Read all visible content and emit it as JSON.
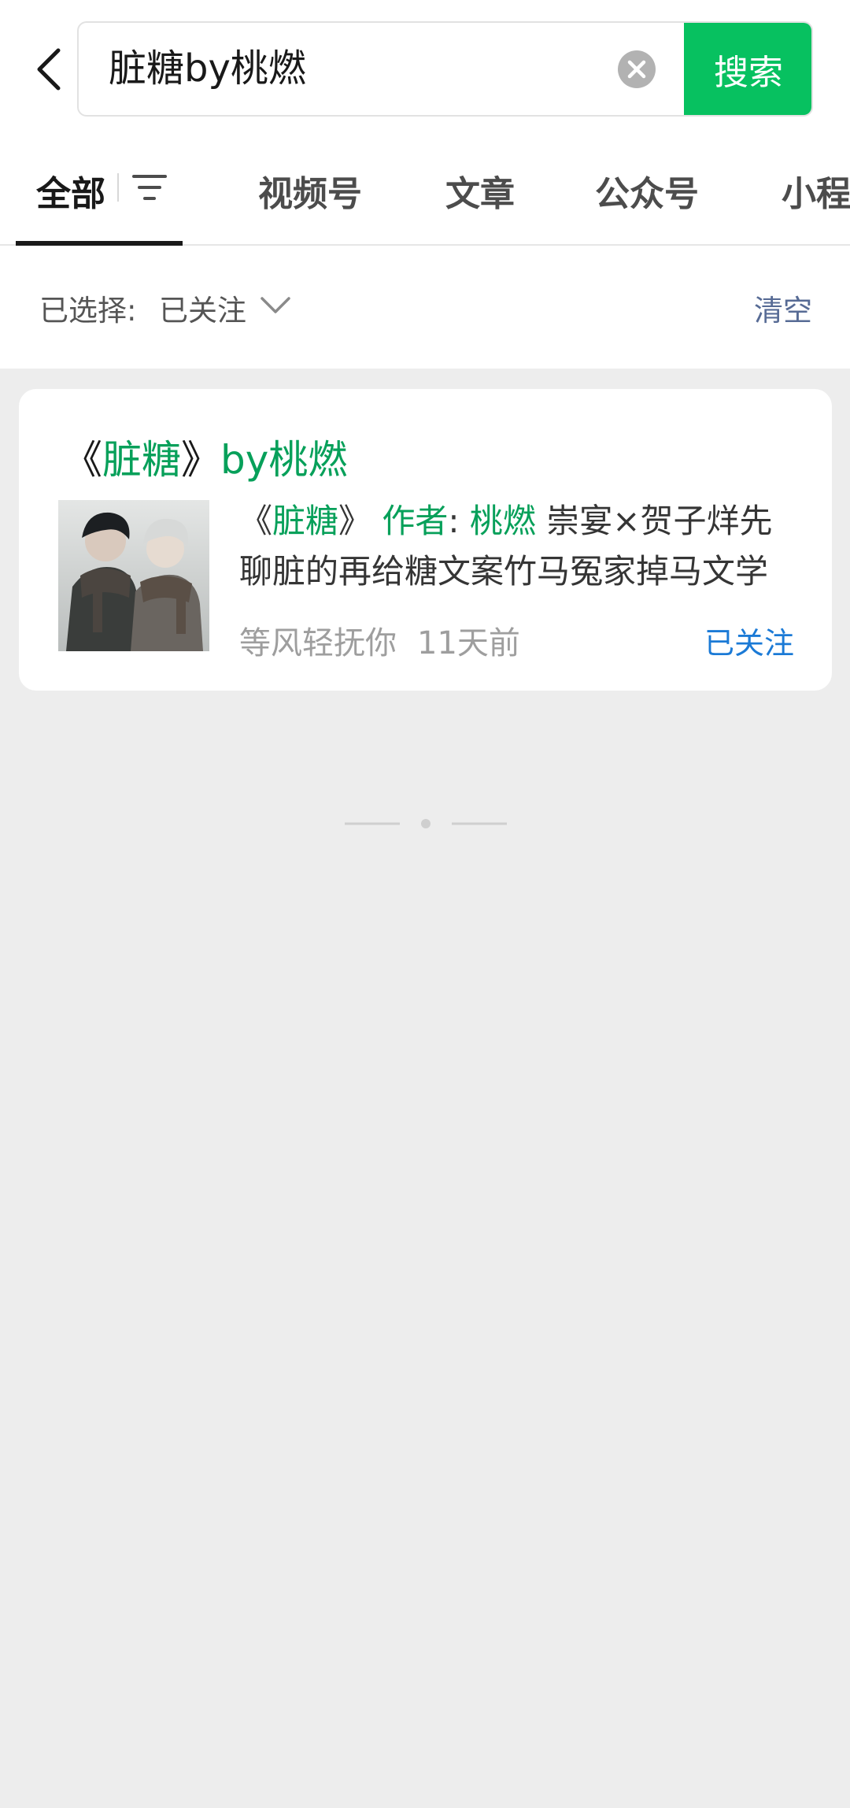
{
  "search": {
    "query": "脏糖by桃燃",
    "button_label": "搜索"
  },
  "tabs": [
    {
      "label": "全部",
      "active": true
    },
    {
      "label": "视频号"
    },
    {
      "label": "文章"
    },
    {
      "label": "公众号"
    },
    {
      "label": "小程"
    }
  ],
  "filter": {
    "label": "已选择:",
    "value": "已关注",
    "clear_label": "清空"
  },
  "result": {
    "title_pre": "《",
    "title_hl": "脏糖",
    "title_mid": "》",
    "title_hl2": "by桃燃",
    "desc_parts": [
      {
        "text": "《",
        "hl": false
      },
      {
        "text": "脏糖",
        "hl": true
      },
      {
        "text": "》 ",
        "hl": false
      },
      {
        "text": "作者",
        "hl": true
      },
      {
        "text": ": ",
        "hl": false
      },
      {
        "text": "桃燃",
        "hl": true
      },
      {
        "text": " 崇宴×贺子烊先聊脏的再给糖文案竹马冤家掉马文学",
        "hl": false
      }
    ],
    "source": "等风轻抚你",
    "time": "11天前",
    "badge": "已关注"
  },
  "colors": {
    "accent": "#07c160",
    "highlight": "#07a05a",
    "link": "#576b95",
    "followed": "#1b7ad6"
  },
  "icons": [
    "back-arrow-icon",
    "clear-circle-icon",
    "filter-icon",
    "chevron-down-icon"
  ]
}
